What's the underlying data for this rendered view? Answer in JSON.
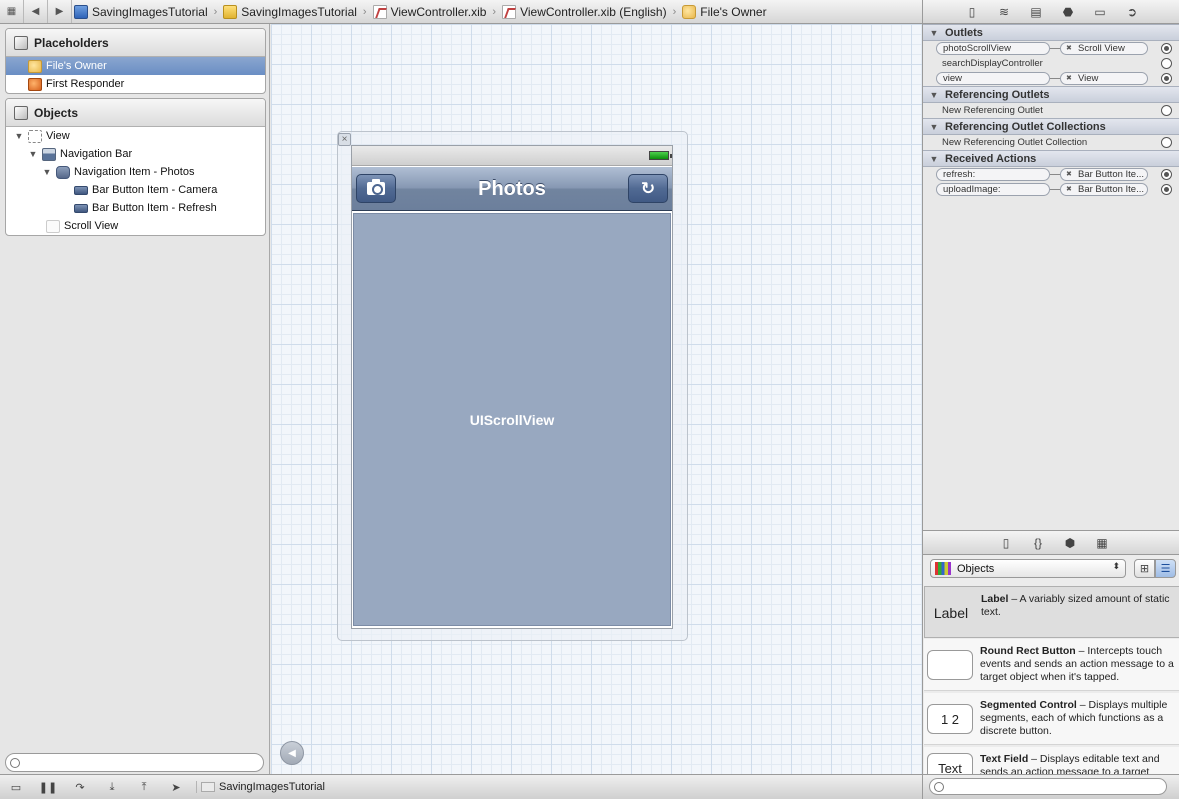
{
  "jumpbar": {
    "breadcrumbs": [
      {
        "label": "SavingImagesTutorial",
        "icon": "project-icon"
      },
      {
        "label": "SavingImagesTutorial",
        "icon": "folder-icon"
      },
      {
        "label": "ViewController.xib",
        "icon": "xib-file-icon"
      },
      {
        "label": "ViewController.xib (English)",
        "icon": "xib-file-icon"
      },
      {
        "label": "File's Owner",
        "icon": "cube-icon"
      }
    ]
  },
  "placeholders": {
    "title": "Placeholders",
    "items": [
      "File's Owner",
      "First Responder"
    ]
  },
  "objects": {
    "title": "Objects",
    "items": [
      "View",
      "Navigation Bar",
      "Navigation Item - Photos",
      "Bar Button Item - Camera",
      "Bar Button Item - Refresh",
      "Scroll View"
    ]
  },
  "canvas": {
    "nav_title": "Photos",
    "scroll_label": "UIScrollView"
  },
  "inspector": {
    "outlets_title": "Outlets",
    "outlets": [
      {
        "name": "photoScrollView",
        "target": "Scroll View",
        "connected": true
      },
      {
        "name": "searchDisplayController",
        "target": "",
        "connected": false
      },
      {
        "name": "view",
        "target": "View",
        "connected": true
      }
    ],
    "referencing_title": "Referencing Outlets",
    "referencing_new": "New Referencing Outlet",
    "collections_title": "Referencing Outlet Collections",
    "collections_new": "New Referencing Outlet Collection",
    "actions_title": "Received Actions",
    "actions": [
      {
        "name": "refresh:",
        "target": "Bar Button Ite..."
      },
      {
        "name": "uploadImage:",
        "target": "Bar Button Ite..."
      }
    ]
  },
  "library": {
    "selector": "Objects",
    "items": [
      {
        "thumb": "Label",
        "name": "Label",
        "desc": " – A variably sized amount of static text."
      },
      {
        "thumb": "",
        "name": "Round Rect Button",
        "desc": " – Intercepts touch events and sends an action message to a target object when it's tapped."
      },
      {
        "thumb": "1 2",
        "name": "Segmented Control",
        "desc": " – Displays multiple segments, each of which functions as a discrete button."
      },
      {
        "thumb": "Text",
        "name": "Text Field",
        "desc": " – Displays editable text and sends an action message to a target"
      }
    ]
  },
  "bottombar": {
    "scheme": "SavingImagesTutorial"
  },
  "colors": {
    "nav_bar": "#7d8fab",
    "scroll_view": "#98a8c0",
    "selection": "#7a9bcb"
  }
}
